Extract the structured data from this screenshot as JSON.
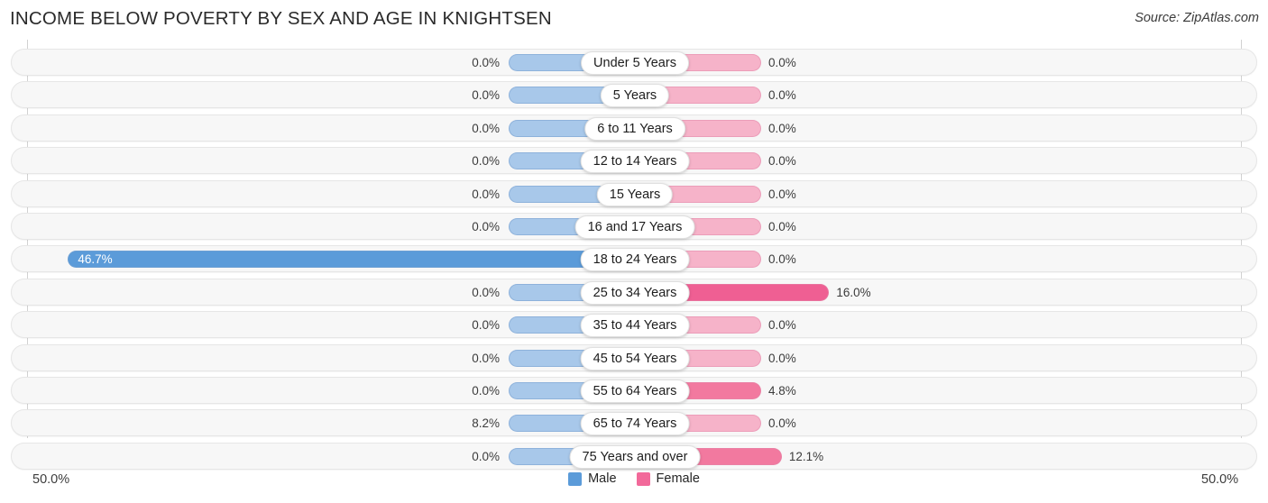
{
  "header": {
    "title": "INCOME BELOW POVERTY BY SEX AND AGE IN KNIGHTSEN",
    "source": "Source: ZipAtlas.com"
  },
  "axis": {
    "left_cap": "50.0%",
    "right_cap": "50.0%"
  },
  "legend": {
    "items": [
      {
        "label": "Male",
        "color": "#5b9bd9"
      },
      {
        "label": "Female",
        "color": "#f2699a"
      }
    ]
  },
  "colors": {
    "male_strong": "#5b9bd9",
    "male_pale": "#a8c8ea",
    "female_strong": "#ef5f93",
    "female_mid": "#f2799f",
    "female_pale": "#f6b3c9",
    "row_bg": "#f7f7f7",
    "axis": "#d2d2d2"
  },
  "chart_data": {
    "type": "bar",
    "subtype": "diverging-population-pyramid",
    "title": "INCOME BELOW POVERTY BY SEX AND AGE IN KNIGHTSEN",
    "xlabel": "",
    "ylabel": "",
    "xlim": [
      -50.0,
      50.0
    ],
    "axis_max_percent": 50.0,
    "grid": false,
    "legend_position": "bottom-center",
    "value_format": "{v}%",
    "categories": [
      "Under 5 Years",
      "5 Years",
      "6 to 11 Years",
      "12 to 14 Years",
      "15 Years",
      "16 and 17 Years",
      "18 to 24 Years",
      "25 to 34 Years",
      "35 to 44 Years",
      "45 to 54 Years",
      "55 to 64 Years",
      "65 to 74 Years",
      "75 Years and over"
    ],
    "series": [
      {
        "name": "Male",
        "side": "left",
        "color": "#5b9bd9",
        "values": [
          0.0,
          0.0,
          0.0,
          0.0,
          0.0,
          0.0,
          46.7,
          0.0,
          0.0,
          0.0,
          0.0,
          8.2,
          0.0
        ],
        "labels": [
          "0.0%",
          "0.0%",
          "0.0%",
          "0.0%",
          "0.0%",
          "0.0%",
          "46.7%",
          "0.0%",
          "0.0%",
          "0.0%",
          "0.0%",
          "8.2%",
          "0.0%"
        ]
      },
      {
        "name": "Female",
        "side": "right",
        "color": "#f2699a",
        "values": [
          0.0,
          0.0,
          0.0,
          0.0,
          0.0,
          0.0,
          0.0,
          16.0,
          0.0,
          0.0,
          4.8,
          0.0,
          12.1
        ],
        "labels": [
          "0.0%",
          "0.0%",
          "0.0%",
          "0.0%",
          "0.0%",
          "0.0%",
          "0.0%",
          "16.0%",
          "0.0%",
          "0.0%",
          "4.8%",
          "0.0%",
          "12.1%"
        ]
      }
    ]
  }
}
